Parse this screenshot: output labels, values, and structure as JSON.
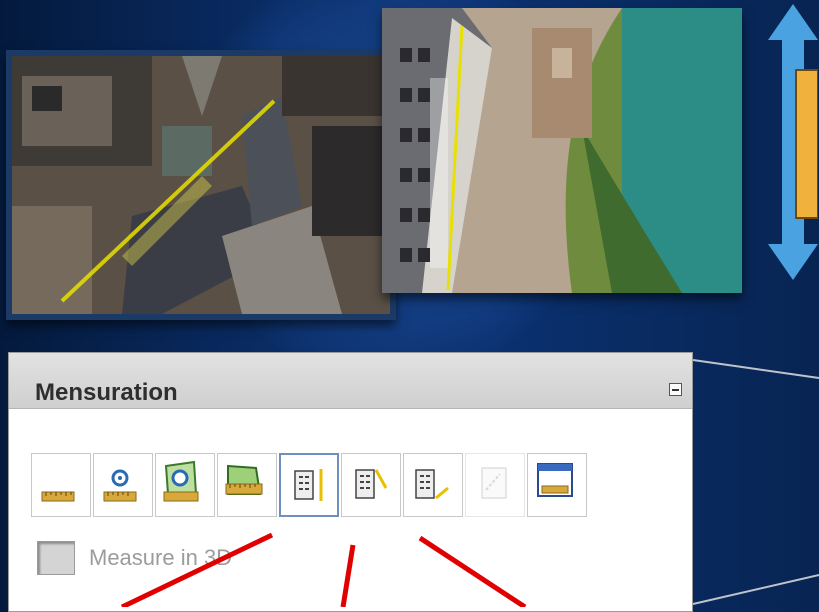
{
  "panel": {
    "title": "Mensuration",
    "collapse_icon": "minus-icon",
    "tools": [
      {
        "name": "measure-distance-tool",
        "icon": "ruler-icon",
        "state": "normal"
      },
      {
        "name": "measure-point-tool",
        "icon": "ruler-point-icon",
        "state": "normal"
      },
      {
        "name": "measure-area-tool",
        "icon": "ruler-area-icon",
        "state": "normal"
      },
      {
        "name": "measure-perimeter-tool",
        "icon": "ruler-perimeter-icon",
        "state": "normal"
      },
      {
        "name": "measure-height-base-top-tool",
        "icon": "building-height-icon",
        "state": "active"
      },
      {
        "name": "measure-height-base-shadow-tool",
        "icon": "building-shadow-icon",
        "state": "normal"
      },
      {
        "name": "measure-height-top-shadow-tool",
        "icon": "building-shadow-slant-icon",
        "state": "normal"
      },
      {
        "name": "clear-tool",
        "icon": "document-disabled-icon",
        "state": "disabled"
      },
      {
        "name": "results-window-tool",
        "icon": "window-ruler-icon",
        "state": "normal"
      }
    ],
    "checkbox": {
      "label": "Measure in 3D",
      "checked": false
    }
  },
  "images": {
    "left": "aerial-oblique-building-distance",
    "right": "aerial-oblique-tower-height"
  },
  "colors": {
    "background": "#0a2d66",
    "arrow": "#4aa3e0",
    "highlight_line": "#e8e000",
    "callout": "#e00000"
  }
}
